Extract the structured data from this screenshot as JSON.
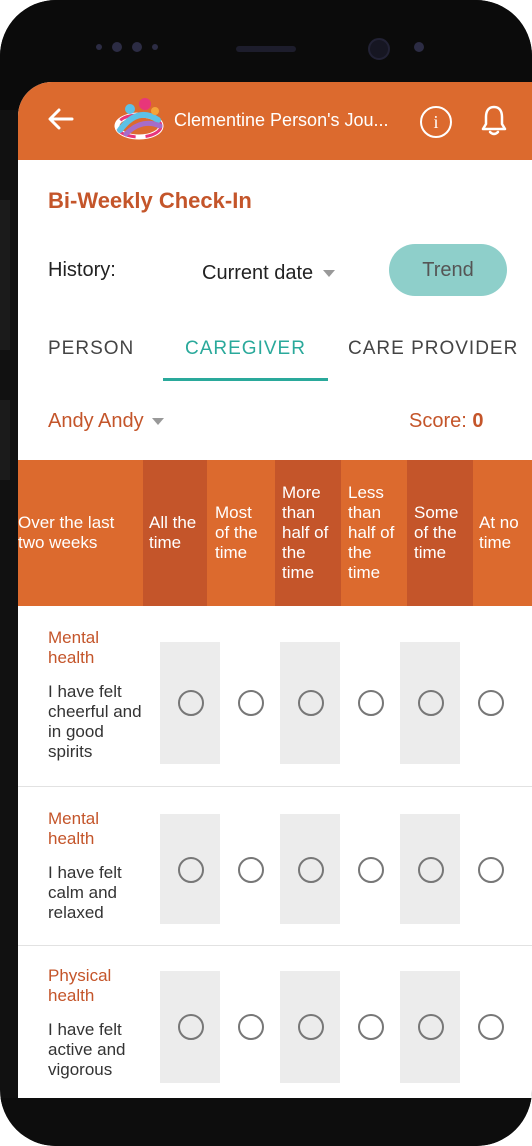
{
  "appbar": {
    "title": "Clementine Person's Jou...",
    "info_icon": "info-icon",
    "bell_icon": "bell-icon",
    "back_icon": "back-arrow-icon"
  },
  "section_title": "Bi-Weekly Check-In",
  "history": {
    "label": "History:",
    "selected": "Current date",
    "trend_label": "Trend"
  },
  "tabs": [
    {
      "label": "PERSON",
      "active": false
    },
    {
      "label": "CAREGIVER",
      "active": true
    },
    {
      "label": "CARE PROVIDER",
      "active": false
    }
  ],
  "person": {
    "name": "Andy Andy",
    "score_label": "Score:",
    "score_value": "0"
  },
  "table": {
    "header_first": [
      "Over the last",
      "two weeks"
    ],
    "columns": [
      [
        "All the",
        "time"
      ],
      [
        "Most",
        "of the",
        "time"
      ],
      [
        "More",
        "than",
        "half of",
        "the",
        "time"
      ],
      [
        "Less",
        "than",
        "half of",
        "the",
        "time"
      ],
      [
        "Some",
        "of the",
        "time"
      ],
      [
        "At no",
        "time"
      ]
    ],
    "rows": [
      {
        "category": [
          "Mental",
          "health"
        ],
        "question": [
          "I have felt",
          "cheerful and",
          "in good",
          "spirits"
        ]
      },
      {
        "category": [
          "Mental",
          "health"
        ],
        "question": [
          "I have felt",
          "calm and",
          "relaxed"
        ]
      },
      {
        "category": [
          "Physical",
          "health"
        ],
        "question": [
          "I have felt",
          "active and",
          "vigorous"
        ]
      }
    ]
  },
  "colors": {
    "brand": "#dc6a2e",
    "brand_dark": "#c4552a",
    "accent": "#2aa99b",
    "trend_button": "#8ecfca"
  }
}
